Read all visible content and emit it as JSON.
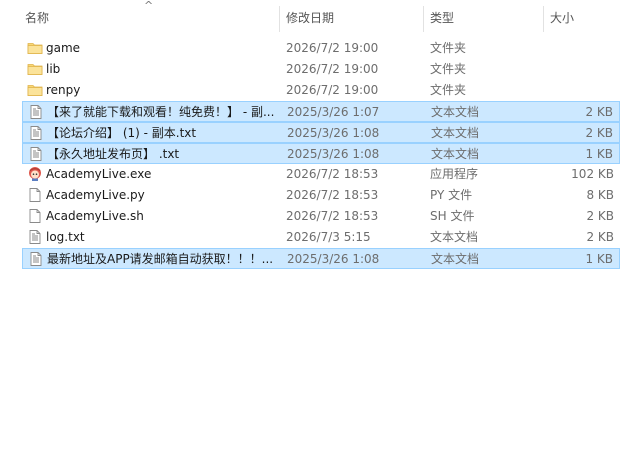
{
  "header": {
    "sort_indicator": "^",
    "columns": {
      "name": "名称",
      "date": "修改日期",
      "type": "类型",
      "size": "大小"
    }
  },
  "files": [
    {
      "name": "game",
      "date": "2026/7/2 19:00",
      "type": "文件夹",
      "size": "",
      "icon": "folder-icon",
      "selected": false
    },
    {
      "name": "lib",
      "date": "2026/7/2 19:00",
      "type": "文件夹",
      "size": "",
      "icon": "folder-icon",
      "selected": false
    },
    {
      "name": "renpy",
      "date": "2026/7/2 19:00",
      "type": "文件夹",
      "size": "",
      "icon": "folder-icon",
      "selected": false
    },
    {
      "name": "【来了就能下载和观看！纯免费！】 - 副...",
      "date": "2025/3/26 1:07",
      "type": "文本文档",
      "size": "2 KB",
      "icon": "text-file-icon",
      "selected": true
    },
    {
      "name": "【论坛介绍】 (1) - 副本.txt",
      "date": "2025/3/26 1:08",
      "type": "文本文档",
      "size": "2 KB",
      "icon": "text-file-icon",
      "selected": true
    },
    {
      "name": "【永久地址发布页】 .txt",
      "date": "2025/3/26 1:08",
      "type": "文本文档",
      "size": "1 KB",
      "icon": "text-file-icon",
      "selected": true
    },
    {
      "name": "AcademyLive.exe",
      "date": "2026/7/2 18:53",
      "type": "应用程序",
      "size": "102 KB",
      "icon": "app-exe-icon",
      "selected": false
    },
    {
      "name": "AcademyLive.py",
      "date": "2026/7/2 18:53",
      "type": "PY 文件",
      "size": "8 KB",
      "icon": "blank-file-icon",
      "selected": false
    },
    {
      "name": "AcademyLive.sh",
      "date": "2026/7/2 18:53",
      "type": "SH 文件",
      "size": "2 KB",
      "icon": "blank-file-icon",
      "selected": false
    },
    {
      "name": "log.txt",
      "date": "2026/7/3 5:15",
      "type": "文本文档",
      "size": "2 KB",
      "icon": "text-file-icon",
      "selected": false
    },
    {
      "name": "最新地址及APP请发邮箱自动获取！！！...",
      "date": "2025/3/26 1:08",
      "type": "文本文档",
      "size": "1 KB",
      "icon": "text-file-icon",
      "selected": true
    }
  ],
  "colors": {
    "selection_fill": "#cce8ff",
    "selection_border": "#99d1ff",
    "folder": "#f8d775"
  }
}
